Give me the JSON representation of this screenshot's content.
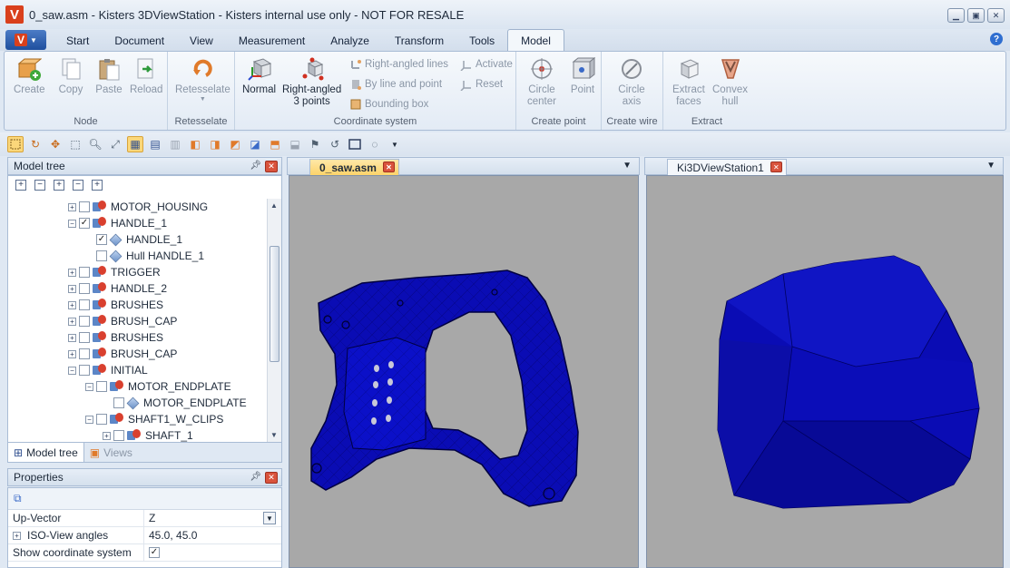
{
  "window": {
    "title": "0_saw.asm - Kisters 3DViewStation - Kisters internal use only - NOT FOR RESALE",
    "app_icon_letter": "V",
    "menu_letter": "V"
  },
  "tabs": [
    "Start",
    "Document",
    "View",
    "Measurement",
    "Analyze",
    "Transform",
    "Tools",
    "Model"
  ],
  "active_tab": "Model",
  "help_label": "?",
  "ribbon": {
    "node": {
      "label": "Node",
      "create": "Create",
      "copy": "Copy",
      "paste": "Paste",
      "reload": "Reload"
    },
    "retesselate": {
      "label": "Retesselate",
      "button": "Retesselate"
    },
    "coordinate_system": {
      "label": "Coordinate system",
      "normal": "Normal",
      "right_angled_3pts_1": "Right-angled",
      "right_angled_3pts_2": "3 points",
      "right_angled_lines": "Right-angled lines",
      "by_line_and_point": "By line and point",
      "bounding_box": "Bounding box",
      "activate": "Activate",
      "reset": "Reset"
    },
    "create_point": {
      "label": "Create point",
      "circle_center_1": "Circle",
      "circle_center_2": "center",
      "point": "Point"
    },
    "create_wire": {
      "label": "Create wire",
      "circle_axis_1": "Circle",
      "circle_axis_2": "axis"
    },
    "extract": {
      "label": "Extract",
      "extract_faces_1": "Extract",
      "extract_faces_2": "faces",
      "convex_hull_1": "Convex",
      "convex_hull_2": "hull"
    }
  },
  "model_tree": {
    "title": "Model tree",
    "rows": [
      {
        "label": "MOTOR_HOUSING",
        "level": 3,
        "checked": false,
        "kind": "asm"
      },
      {
        "label": "HANDLE_1",
        "level": 3,
        "checked": true,
        "kind": "asm",
        "expanded": true
      },
      {
        "label": "HANDLE_1",
        "level": 4,
        "checked": true,
        "kind": "part"
      },
      {
        "label": "Hull HANDLE_1",
        "level": 4,
        "checked": false,
        "kind": "part"
      },
      {
        "label": "TRIGGER",
        "level": 3,
        "checked": false,
        "kind": "asm"
      },
      {
        "label": "HANDLE_2",
        "level": 3,
        "checked": false,
        "kind": "asm"
      },
      {
        "label": "BRUSHES",
        "level": 3,
        "checked": false,
        "kind": "asm"
      },
      {
        "label": "BRUSH_CAP",
        "level": 3,
        "checked": false,
        "kind": "asm"
      },
      {
        "label": "BRUSHES",
        "level": 3,
        "checked": false,
        "kind": "asm"
      },
      {
        "label": "BRUSH_CAP",
        "level": 3,
        "checked": false,
        "kind": "asm"
      },
      {
        "label": "INITIAL",
        "level": 3,
        "checked": false,
        "kind": "asm",
        "expanded": true
      },
      {
        "label": "MOTOR_ENDPLATE",
        "level": 4,
        "checked": false,
        "kind": "asm",
        "expanded": true
      },
      {
        "label": "MOTOR_ENDPLATE",
        "level": 5,
        "checked": false,
        "kind": "part"
      },
      {
        "label": "SHAFT1_W_CLIPS",
        "level": 4,
        "checked": false,
        "kind": "asm",
        "expanded": true
      },
      {
        "label": "SHAFT_1",
        "level": 5,
        "checked": false,
        "kind": "asm"
      }
    ],
    "bottom_tabs": [
      "Model tree",
      "Views"
    ]
  },
  "properties": {
    "title": "Properties",
    "rows": [
      {
        "name": "Up-Vector",
        "value": "Z"
      },
      {
        "name": "ISO-View angles",
        "value": "45.0, 45.0"
      },
      {
        "name": "Show coordinate system",
        "value": "✓"
      }
    ]
  },
  "viewports": {
    "left_tab": "0_saw.asm",
    "right_tab": "Ki3DViewStation1"
  },
  "colors": {
    "model_blue": "#0a0cb4",
    "viewport_bg": "#a8a8a8",
    "accent_orange": "#fcd36a"
  }
}
